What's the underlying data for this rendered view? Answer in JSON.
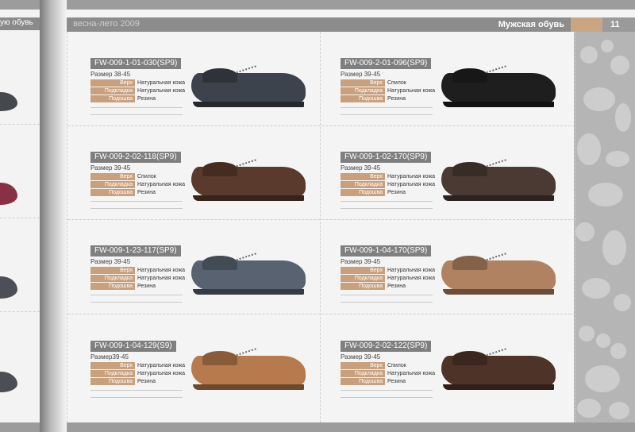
{
  "header": {
    "season": "весна-лето 2009",
    "section": "Мужская обувь",
    "page_number": "11"
  },
  "left_page": {
    "bar_label": "ую обувь"
  },
  "colors": {
    "accent": "#c9a07d",
    "header_bar": "#8c8c8c",
    "code_bar": "#7f7f7f"
  },
  "products": [
    {
      "code": "FW-009-1-01-030(SP9)",
      "size": "Размер 38-45",
      "specs": [
        {
          "label": "Верх",
          "value": "Натуральная кожа"
        },
        {
          "label": "Подкладка",
          "value": "Натуральная кожа"
        },
        {
          "label": "Подошва",
          "value": "Резина"
        }
      ],
      "shoe_color": "#3d434c"
    },
    {
      "code": "FW-009-2-01-096(SP9)",
      "size": "Размер 39-45",
      "specs": [
        {
          "label": "Верх",
          "value": "Спилок"
        },
        {
          "label": "Подкладка",
          "value": "Натуральная кожа"
        },
        {
          "label": "Подошва",
          "value": "Резина"
        }
      ],
      "shoe_color": "#1e1e1e"
    },
    {
      "code": "FW-009-2-02-118(SP9)",
      "size": "Размер 39-45",
      "specs": [
        {
          "label": "Верх",
          "value": "Спилок"
        },
        {
          "label": "Подкладка",
          "value": "Натуральная кожа"
        },
        {
          "label": "Подошва",
          "value": "Резина"
        }
      ],
      "shoe_color": "#5a3a2c"
    },
    {
      "code": "FW-009-1-02-170(SP9)",
      "size": "Размер 39-45",
      "specs": [
        {
          "label": "Верх",
          "value": "Натуральная кожа"
        },
        {
          "label": "Подкладка",
          "value": "Натуральная кожа"
        },
        {
          "label": "Подошва",
          "value": "Резина"
        }
      ],
      "shoe_color": "#4a3a33"
    },
    {
      "code": "FW-009-1-23-117(SP9)",
      "size": "Размер 39-45",
      "specs": [
        {
          "label": "Верх",
          "value": "Натуральная кожа"
        },
        {
          "label": "Подкладка",
          "value": "Натуральная кожа"
        },
        {
          "label": "Подошва",
          "value": "Резина"
        }
      ],
      "shoe_color": "#586270"
    },
    {
      "code": "FW-009-1-04-170(SP9)",
      "size": "Размер 39-45",
      "specs": [
        {
          "label": "Верх",
          "value": "Натуральная кожа"
        },
        {
          "label": "Подкладка",
          "value": "Натуральная кожа"
        },
        {
          "label": "Подошва",
          "value": "Резина"
        }
      ],
      "shoe_color": "#b08262"
    },
    {
      "code": "FW-009-1-04-129(S9)",
      "size": "Размер39-45",
      "specs": [
        {
          "label": "Верх",
          "value": "Натуральная кожа"
        },
        {
          "label": "Подкладка",
          "value": "Натуральная кожа"
        },
        {
          "label": "Подошва",
          "value": "Резина"
        }
      ],
      "shoe_color": "#b67a4c"
    },
    {
      "code": "FW-009-2-02-122(SP9)",
      "size": "Размер 39-45",
      "specs": [
        {
          "label": "Верх",
          "value": "Спилок"
        },
        {
          "label": "Подкладка",
          "value": "Натуральная кожа"
        },
        {
          "label": "Подошва",
          "value": "Резина"
        }
      ],
      "shoe_color": "#4e3428"
    }
  ]
}
